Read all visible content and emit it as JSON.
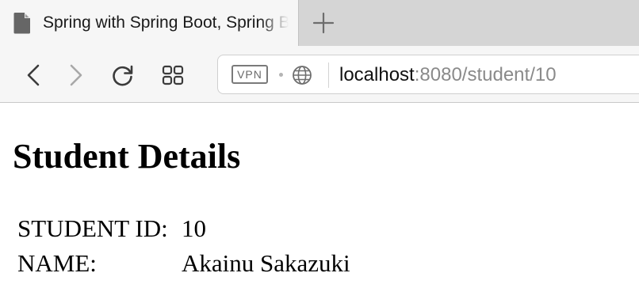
{
  "browser": {
    "tab": {
      "title": "Spring with Spring Boot, Spring Boot"
    },
    "address": {
      "vpn_label": "VPN",
      "url_host": "localhost",
      "url_rest": ":8080/student/10"
    }
  },
  "page": {
    "title": "Student Details",
    "fields": [
      {
        "label": "STUDENT ID:",
        "value": "10"
      },
      {
        "label": "NAME:",
        "value": "Akainu Sakazuki"
      }
    ]
  },
  "icons": {
    "tab": "document-icon",
    "new_tab": "plus-icon",
    "back": "chevron-left-icon",
    "forward": "chevron-right-icon",
    "reload": "reload-icon",
    "speed_dial": "grid-icon",
    "site_info": "globe-icon"
  },
  "colors": {
    "tabbar_bg": "#d5d5d5",
    "active_tab_bg": "#f6f6f6",
    "url_secondary": "#8a8a8a"
  }
}
